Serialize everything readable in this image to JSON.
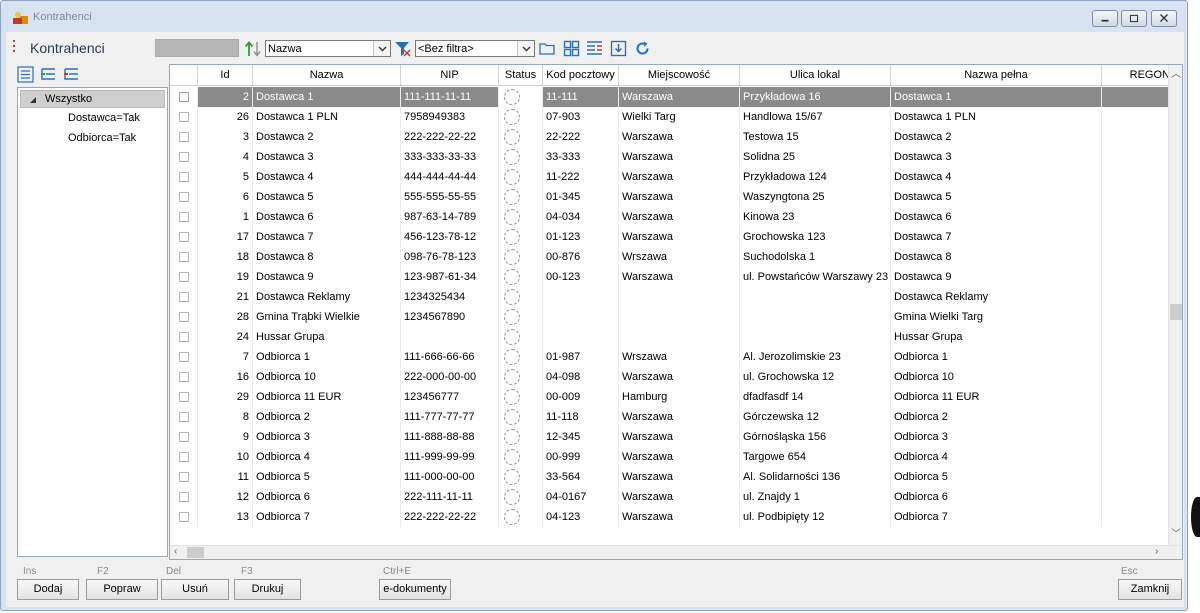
{
  "window": {
    "title": "Kontrahenci"
  },
  "toolbar": {
    "title": "Kontrahenci",
    "sort_field": "Nazwa",
    "filter": "<Bez filtra>"
  },
  "tree": {
    "items": [
      {
        "label": "Wszystko"
      },
      {
        "label": "Dostawca=Tak"
      },
      {
        "label": "Odbiorca=Tak"
      }
    ]
  },
  "grid": {
    "columns": [
      "Id",
      "Nazwa",
      "NIP",
      "Status",
      "Kod pocztowy",
      "Miejscowość",
      "Ulica lokal",
      "Nazwa pełna",
      "REGON"
    ],
    "rows": [
      [
        "2",
        "Dostawca 1",
        "111-111-11-11",
        "11-111",
        "Warszawa",
        "Przykładowa 16",
        "Dostawca 1"
      ],
      [
        "26",
        "Dostawca 1 PLN",
        "7958949383",
        "07-903",
        "Wielki Targ",
        "Handlowa 15/67",
        "Dostawca 1 PLN"
      ],
      [
        "3",
        "Dostawca 2",
        "222-222-22-22",
        "22-222",
        "Warszawa",
        "Testowa 15",
        "Dostawca 2"
      ],
      [
        "4",
        "Dostawca 3",
        "333-333-33-33",
        "33-333",
        "Warszawa",
        "Solidna 25",
        "Dostawca 3"
      ],
      [
        "5",
        "Dostawca 4",
        "444-444-44-44",
        "11-222",
        "Warszawa",
        "Przykładowa 124",
        "Dostawca 4"
      ],
      [
        "6",
        "Dostawca 5",
        "555-555-55-55",
        "01-345",
        "Warszawa",
        "Waszyngtona 25",
        "Dostawca 5"
      ],
      [
        "1",
        "Dostawca 6",
        "987-63-14-789",
        "04-034",
        "Warszawa",
        "Kinowa 23",
        "Dostawca 6"
      ],
      [
        "17",
        "Dostawca 7",
        "456-123-78-12",
        "01-123",
        "Warszawa",
        "Grochowska 123",
        "Dostawca 7"
      ],
      [
        "18",
        "Dostawca 8",
        "098-76-78-123",
        "00-876",
        "Wrszawa",
        "Suchodolska 1",
        "Dostawca 8"
      ],
      [
        "19",
        "Dostawca 9",
        "123-987-61-34",
        "00-123",
        "Warszawa",
        "ul. Powstańców Warszawy 23",
        "Dostawca 9"
      ],
      [
        "21",
        "Dostawca Reklamy",
        "1234325434",
        "",
        "",
        "",
        "Dostawca Reklamy"
      ],
      [
        "28",
        "Gmina Trąbki Wielkie",
        "1234567890",
        "",
        "",
        "",
        "Gmina Wielki Targ"
      ],
      [
        "24",
        "Hussar Grupa",
        "",
        "",
        "",
        "",
        "Hussar Grupa"
      ],
      [
        "7",
        "Odbiorca 1",
        "111-666-66-66",
        "01-987",
        "Wrszawa",
        "Al. Jerozolimskie 23",
        "Odbiorca 1"
      ],
      [
        "16",
        "Odbiorca 10",
        "222-000-00-00",
        "04-098",
        "Warszawa",
        "ul. Grochowska 12",
        "Odbiorca 10"
      ],
      [
        "29",
        "Odbiorca 11 EUR",
        "123456777",
        "00-009",
        "Hamburg",
        "dfadfasdf 14",
        "Odbiorca 11 EUR"
      ],
      [
        "8",
        "Odbiorca 2",
        "111-777-77-77",
        "11-118",
        "Warszawa",
        "Górczewska 12",
        "Odbiorca 2"
      ],
      [
        "9",
        "Odbiorca 3",
        "111-888-88-88",
        "12-345",
        "Warszawa",
        "Górnośląska 156",
        "Odbiorca 3"
      ],
      [
        "10",
        "Odbiorca 4",
        "111-999-99-99",
        "00-999",
        "Warszawa",
        "Targowe 654",
        "Odbiorca 4"
      ],
      [
        "11",
        "Odbiorca 5",
        "111-000-00-00",
        "33-564",
        "Warszawa",
        "Al. Solidarności 136",
        "Odbiorca 5"
      ],
      [
        "12",
        "Odbiorca 6",
        "222-111-11-11",
        "04-0167",
        "Warszawa",
        "ul. Znajdy 1",
        "Odbiorca 6"
      ],
      [
        "13",
        "Odbiorca 7",
        "222-222-22-22",
        "04-123",
        "Warszawa",
        "ul. Podbipięty 12",
        "Odbiorca 7"
      ]
    ]
  },
  "footer": {
    "buttons": [
      {
        "key": "Ins",
        "label": "Dodaj"
      },
      {
        "key": "F2",
        "label": "Popraw"
      },
      {
        "key": "Del",
        "label": "Usuń"
      },
      {
        "key": "F3",
        "label": "Drukuj"
      },
      {
        "key": "Ctrl+E",
        "label": "e-dokumenty"
      },
      {
        "key": "Esc",
        "label": "Zamknij"
      }
    ]
  },
  "colors": {
    "selected_row": "#8a8a8a",
    "window_frame": "#d7e3f1"
  }
}
